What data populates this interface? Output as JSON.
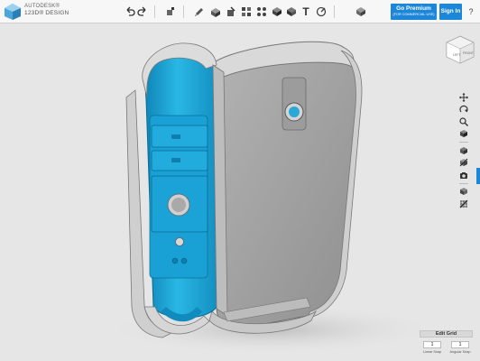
{
  "app": {
    "brand_line1": "AUTODESK®",
    "brand_line2": "123D® DESIGN"
  },
  "toolbar": {
    "undo_icon": "undo-icon",
    "redo_icon": "redo-icon",
    "text_tool_label": "T",
    "premium_label": "Go Premium",
    "premium_sub": "(FOR COMMERCIAL USE)",
    "signin_label": "Sign In",
    "help_label": "?"
  },
  "navcube": {
    "front_label": "LEFT",
    "right_label": "FRONT"
  },
  "right_toolbar": {
    "icons": [
      "pan-icon",
      "orbit-icon",
      "zoom-icon",
      "fit-icon",
      "view-box-icon",
      "hide-icon",
      "camera-icon",
      "material-icon",
      "grid-toggle-icon"
    ]
  },
  "edit_grid": {
    "title": "Edit Grid",
    "linear_value": "1",
    "angular_value": "1",
    "linear_label": "Linear Snap",
    "angular_label": "Angular Snap"
  },
  "colors": {
    "accent": "#1c86d9",
    "model_blue": "#1fa6d6",
    "model_gray": "#a4a4a4",
    "background": "#e6e6e6"
  }
}
